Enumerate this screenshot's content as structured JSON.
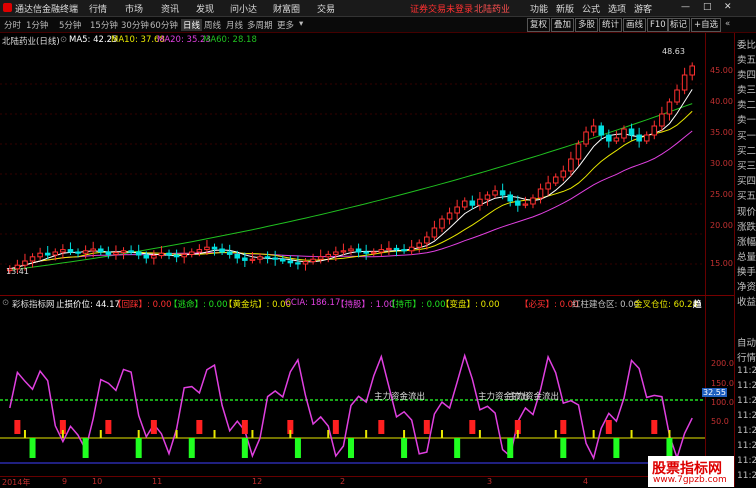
{
  "menubar": {
    "app_title": "通达信金融终端",
    "items": [
      "行情",
      "市场",
      "资讯",
      "发现",
      "问小达",
      "财富圈",
      "交易"
    ],
    "login_warning": "证券交易未登录",
    "stock_name": "北陆药业",
    "right_items": [
      "功能",
      "新版",
      "公式",
      "选项",
      "游客"
    ]
  },
  "toolbar": {
    "periods": [
      "分时",
      "1分钟",
      "5分钟",
      "15分钟",
      "30分钟",
      "60分钟",
      "日线",
      "周线",
      "月线",
      "多周期",
      "更多"
    ],
    "active_period": "日线",
    "buttons": [
      "复权",
      "叠加",
      "多股",
      "统计",
      "画线",
      "F10",
      "标记",
      "+自选"
    ]
  },
  "main_legend": {
    "title": "北陆药业(日线)",
    "items": [
      {
        "label": "MA5: 42.25",
        "color": "#ffffff"
      },
      {
        "label": "MA10: 37.68",
        "color": "#e8e800"
      },
      {
        "label": "MA20: 35.23",
        "color": "#e040e0"
      },
      {
        "label": "MA60: 28.18",
        "color": "#20c020"
      }
    ]
  },
  "price_axis": [
    "45.00",
    "40.00",
    "35.00",
    "30.00",
    "25.00",
    "20.00",
    "15.00"
  ],
  "high_label": "48.63",
  "low_label": "13.41",
  "indicator_legend": {
    "name": "彩标指标网",
    "items": [
      {
        "label": "止损价位: 44.17",
        "color": "#ffffff"
      },
      {
        "label": "【回踩】: 0.00",
        "color": "#ff3030"
      },
      {
        "label": "【逃命】: 0.00",
        "color": "#20e020"
      },
      {
        "label": "【黄金坑】: 0.00",
        "color": "#e8e800"
      },
      {
        "label": "CCIA: 186.17",
        "color": "#e040e0"
      },
      {
        "label": "【持股】: 1.00",
        "color": "#e040e0"
      },
      {
        "label": "【持币】: 0.00",
        "color": "#20e020"
      },
      {
        "label": "【变盘】: 0.00",
        "color": "#e8e800"
      },
      {
        "label": "【必买】: 0.00",
        "color": "#ff3030"
      },
      {
        "label": "红柱建仓区: 0.00",
        "color": "#c0c0c0"
      },
      {
        "label": "金叉仓位: 60.24",
        "color": "#e8e800"
      }
    ],
    "trend": "趋"
  },
  "sub_axis": [
    "200.0",
    "150.0",
    "100.0",
    "50.0",
    "32.55"
  ],
  "sub_annotations": [
    "主力资金流出",
    "主力资金流出",
    "主力资金流出"
  ],
  "time_axis": [
    "2014年",
    "9",
    "10",
    "11",
    "12",
    "2",
    "3",
    "4"
  ],
  "right_panel": [
    "委比",
    "卖五",
    "卖四",
    "卖三",
    "卖二",
    "卖一",
    "买一",
    "买二",
    "买三",
    "买四",
    "买五",
    "现价",
    "涨跌",
    "涨幅",
    "总量",
    "换手",
    "净资",
    "收益",
    "自动",
    "行情",
    "11:29",
    "11:29",
    "11:29",
    "11:29",
    "11:29",
    "11:29",
    "11:29",
    "11:29"
  ],
  "watermark": {
    "title": "股票指标网",
    "url": "www.7gpzb.com"
  },
  "colors": {
    "up": "#ff3030",
    "down": "#00e0e0",
    "ma60": "#20c020",
    "ccia": "#e040e0",
    "background": "#000000"
  },
  "chart_data": {
    "type": "candlestick",
    "title": "北陆药业(日线)",
    "ylim": [
      12,
      50
    ],
    "x_ticks": [
      "2014年",
      "9",
      "10",
      "11",
      "12",
      "2",
      "3",
      "4"
    ],
    "ma5": 42.25,
    "ma10": 37.68,
    "ma20": 35.23,
    "ma60": 28.18,
    "high": 48.63,
    "low": 13.41,
    "close": [
      14.2,
      14.8,
      15.5,
      16.2,
      16.8,
      16.5,
      17.0,
      17.4,
      17.0,
      16.8,
      17.2,
      17.5,
      17.0,
      16.6,
      16.9,
      17.2,
      17.0,
      16.5,
      16.0,
      16.4,
      16.8,
      16.5,
      16.2,
      16.6,
      17.0,
      17.4,
      17.8,
      17.5,
      17.0,
      16.6,
      16.0,
      15.6,
      15.8,
      16.2,
      16.0,
      15.8,
      15.5,
      15.2,
      15.0,
      15.4,
      15.8,
      16.2,
      16.6,
      17.0,
      17.2,
      17.5,
      17.0,
      16.8,
      17.0,
      17.4,
      17.6,
      17.4,
      17.2,
      17.8,
      18.5,
      19.5,
      21.0,
      22.5,
      23.5,
      24.5,
      25.5,
      24.8,
      25.8,
      26.5,
      27.2,
      26.5,
      25.5,
      24.8,
      25.0,
      26.0,
      27.5,
      28.5,
      29.5,
      30.5,
      32.5,
      35.0,
      37.0,
      38.0,
      36.5,
      35.5,
      36.0,
      37.5,
      36.5,
      35.5,
      36.5,
      38.0,
      40.0,
      42.0,
      44.0,
      46.5,
      48.0
    ]
  }
}
